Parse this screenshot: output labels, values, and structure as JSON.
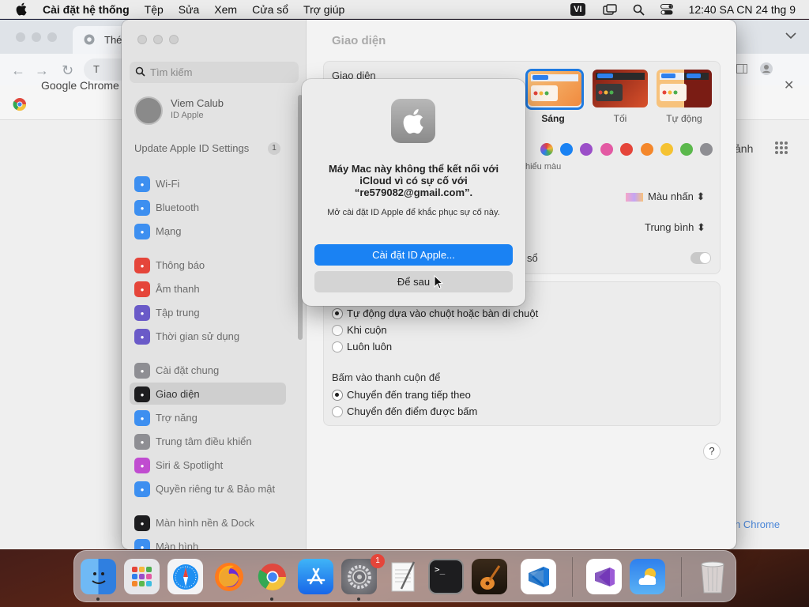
{
  "menubar": {
    "app_name": "Cài đặt hệ thống",
    "items": [
      "Tệp",
      "Sửa",
      "Xem",
      "Cửa sổ",
      "Trợ giúp"
    ],
    "input_source": "VI",
    "clock": "12:40 SA CN 24 thg 9"
  },
  "chrome_bg": {
    "tab_title": "Thé",
    "omni_partial": "T",
    "infobar_text": "Google Chrome",
    "right_text1": "ảnh",
    "right_text2": "h Chrome"
  },
  "settings": {
    "search_placeholder": "Tìm kiếm",
    "profile": {
      "name": "Viem Calub",
      "sub": "ID Apple"
    },
    "update": {
      "label": "Update Apple ID Settings",
      "count": "1"
    },
    "sidebar": [
      {
        "label": "Wi-Fi",
        "icon": "wifi-icon",
        "color": "#3d8ff0"
      },
      {
        "label": "Bluetooth",
        "icon": "bluetooth-icon",
        "color": "#3d8ff0"
      },
      {
        "label": "Mạng",
        "icon": "globe-icon",
        "color": "#3d8ff0"
      },
      {
        "label": "Thông báo",
        "icon": "bell-icon",
        "color": "#e5453a"
      },
      {
        "label": "Âm thanh",
        "icon": "speaker-icon",
        "color": "#e5453a"
      },
      {
        "label": "Tập trung",
        "icon": "moon-icon",
        "color": "#6a5ac8"
      },
      {
        "label": "Thời gian sử dụng",
        "icon": "hourglass-icon",
        "color": "#6a5ac8"
      },
      {
        "label": "Cài đặt chung",
        "icon": "gear-icon",
        "color": "#8e8e93"
      },
      {
        "label": "Giao diện",
        "icon": "appearance-icon",
        "color": "#1d1d1f"
      },
      {
        "label": "Trợ năng",
        "icon": "accessibility-icon",
        "color": "#3d8ff0"
      },
      {
        "label": "Trung tâm điều khiển",
        "icon": "control-center-icon",
        "color": "#8e8e93"
      },
      {
        "label": "Siri & Spotlight",
        "icon": "siri-icon",
        "color": "#c04cd0"
      },
      {
        "label": "Quyền riêng tư & Bảo mật",
        "icon": "hand-icon",
        "color": "#3d8ff0"
      },
      {
        "label": "Màn hình nền & Dock",
        "icon": "dock-icon",
        "color": "#1d1d1f"
      },
      {
        "label": "Màn hình",
        "icon": "sun-icon",
        "color": "#3d8ff0"
      }
    ],
    "main": {
      "title": "Giao diện",
      "appearance_label": "Giao diện",
      "themes": [
        "Sáng",
        "Tối",
        "Tự động"
      ],
      "accent_label": "hiểu màu",
      "highlight_value": "Màu nhấn",
      "sidebar_size_value": "Trung bình",
      "toggle_label": "sổ",
      "scroll_options": [
        "Tự động dựa vào chuột hoặc bàn di chuột",
        "Khi cuộn",
        "Luôn luôn"
      ],
      "click_label": "Bấm vào thanh cuộn để",
      "click_options": [
        "Chuyển đến trang tiếp theo",
        "Chuyển đến điểm được bấm"
      ],
      "help": "?"
    }
  },
  "dialog": {
    "title": "Máy Mac này không thể kết nối với iCloud vì có sự cố với “re579082@gmail.com”.",
    "message": "Mở cài đặt ID Apple để khắc phục sự cố này.",
    "primary": "Cài đặt ID Apple...",
    "secondary": "Để sau"
  },
  "dock": {
    "apps": [
      "Finder",
      "Launchpad",
      "Safari",
      "Firefox",
      "Chrome",
      "App Store",
      "System Settings",
      "TextEdit",
      "Terminal",
      "GarageBand",
      "VS Code",
      "Visual Studio",
      "Weather",
      "Trash"
    ],
    "settings_badge": "1"
  },
  "colors": {
    "accent": "#1a82f3",
    "selection_border": "#1f7ae0"
  }
}
